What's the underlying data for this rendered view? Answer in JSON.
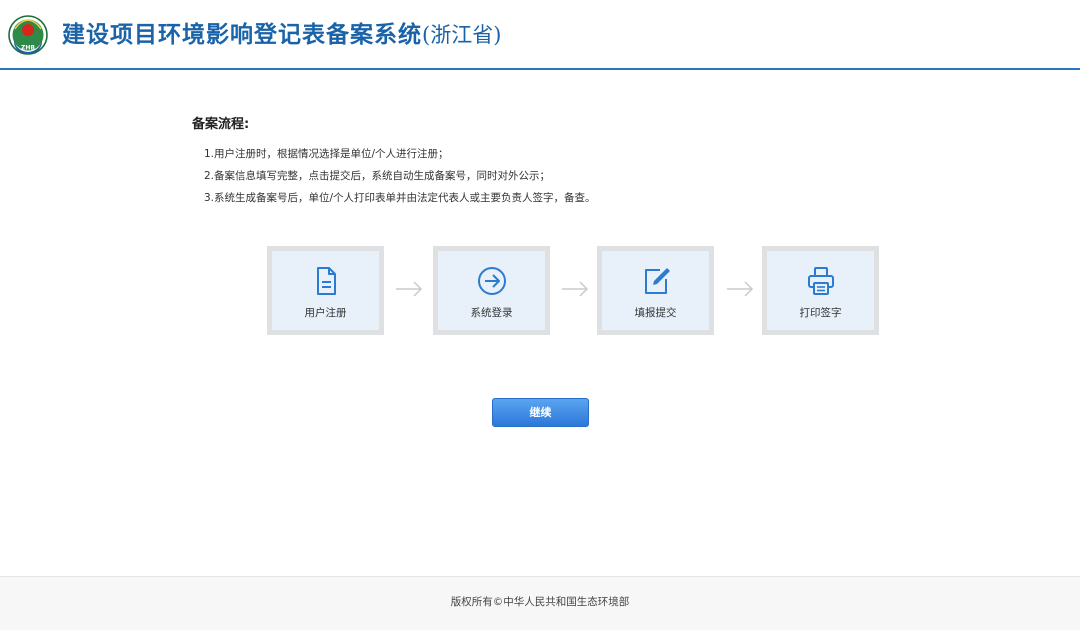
{
  "header": {
    "title_main": "建设项目环境影响登记表备案系统",
    "title_sub": "(浙江省)",
    "logo_icon": "environment-emblem-icon",
    "logo_text": "ZHB",
    "accent_color": "#1a63a8"
  },
  "process": {
    "title": "备案流程:",
    "steps": [
      "1.用户注册时，根据情况选择是单位/个人进行注册；",
      "2.备案信息填写完整，点击提交后，系统自动生成备案号，同时对外公示；",
      "3.系统生成备案号后，单位/个人打印表单并由法定代表人或主要负责人签字，备查。"
    ]
  },
  "flow": [
    {
      "label": "用户注册",
      "icon": "document-icon"
    },
    {
      "label": "系统登录",
      "icon": "arrow-circle-icon"
    },
    {
      "label": "填报提交",
      "icon": "edit-icon"
    },
    {
      "label": "打印签字",
      "icon": "printer-icon"
    }
  ],
  "actions": {
    "continue_label": "继续"
  },
  "footer": {
    "copyright": "版权所有©中华人民共和国生态环境部"
  }
}
